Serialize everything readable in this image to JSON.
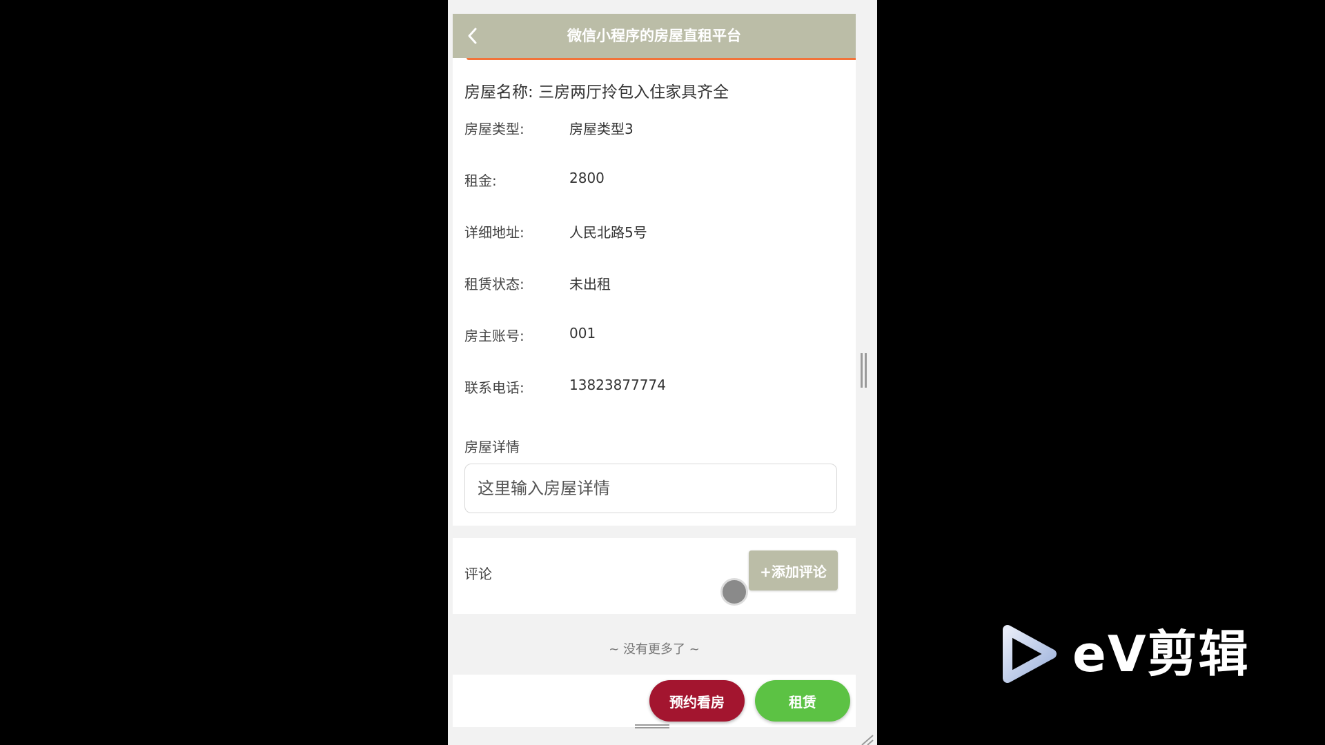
{
  "nav": {
    "title": "微信小程序的房屋直租平台"
  },
  "house": {
    "name_label": "房屋名称:",
    "name_value": "三房两厅拎包入住家具齐全",
    "fields": [
      {
        "label": "房屋类型:",
        "value": "房屋类型3"
      },
      {
        "label": "租金:",
        "value": "2800"
      },
      {
        "label": "详细地址:",
        "value": "人民北路5号"
      },
      {
        "label": "租赁状态:",
        "value": "未出租"
      },
      {
        "label": "房主账号:",
        "value": "001"
      },
      {
        "label": "联系电话:",
        "value": "13823877774"
      }
    ]
  },
  "details": {
    "label": "房屋详情",
    "placeholder": "这里输入房屋详情"
  },
  "comments": {
    "label": "评论",
    "add_button": "+添加评论"
  },
  "footer": {
    "no_more": "~ 没有更多了 ~"
  },
  "actions": {
    "appoint": "预约看房",
    "rent": "租赁"
  },
  "watermark": {
    "text": "eV剪辑"
  },
  "colors": {
    "nav": "#bbbda7",
    "accent": "#f2733a",
    "appoint": "#a3152f",
    "rent": "#5cc244"
  }
}
